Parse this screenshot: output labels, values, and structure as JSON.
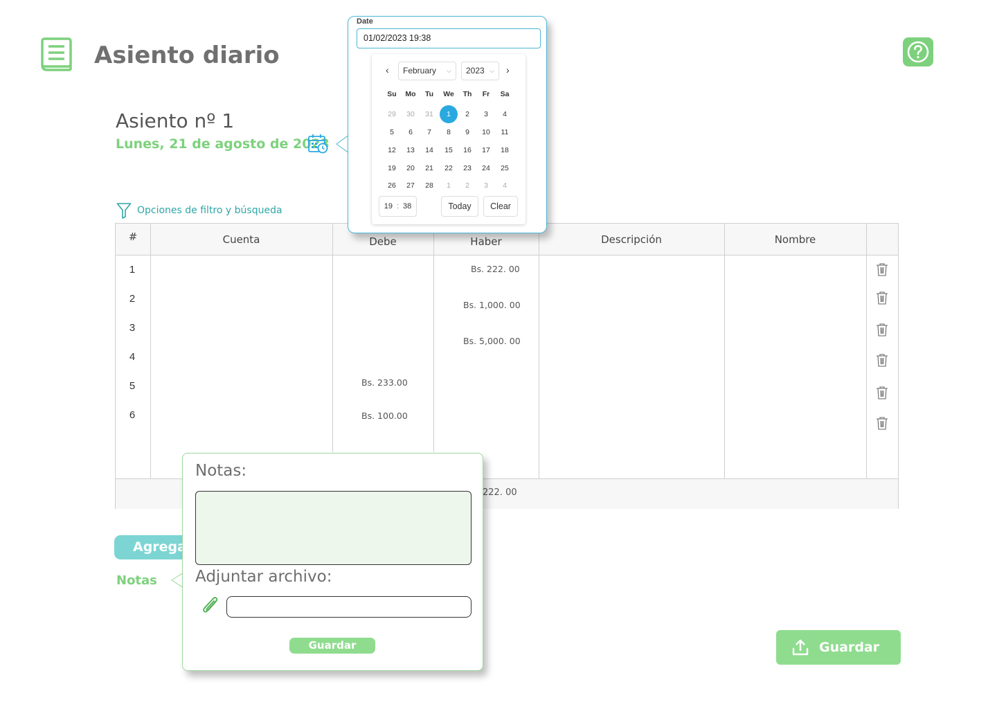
{
  "header": {
    "title": "Asiento diario",
    "book_icon": "book-icon",
    "help_icon": "question-circle-icon",
    "brand_color": "#7dd17d"
  },
  "entry": {
    "title": "Asiento nº 1",
    "date": "Lunes, 21 de agosto de 2023",
    "calendar_icon": "calendar-clock-icon"
  },
  "filter": {
    "label": "Opciones de filtro y búsqueda",
    "icon": "filter-icon"
  },
  "table": {
    "columns": [
      "#",
      "Cuenta",
      "Debe",
      "Haber",
      "Descripción",
      "Nombre",
      ""
    ],
    "rows": [
      {
        "num": "1",
        "cuenta": "",
        "debe": "",
        "haber": "Bs. 222. 00",
        "descripcion": "",
        "nombre": ""
      },
      {
        "num": "2",
        "cuenta": "",
        "debe": "",
        "haber": "Bs. 1,000. 00",
        "descripcion": "",
        "nombre": ""
      },
      {
        "num": "3",
        "cuenta": "",
        "debe": "",
        "haber": "Bs. 5,000. 00",
        "descripcion": "",
        "nombre": ""
      },
      {
        "num": "4",
        "cuenta": "",
        "debe": "",
        "haber": "",
        "descripcion": "",
        "nombre": ""
      },
      {
        "num": "5",
        "cuenta": "",
        "debe": "Bs. 233.00",
        "haber": "",
        "descripcion": "",
        "nombre": ""
      },
      {
        "num": "6",
        "cuenta": "",
        "debe": "Bs. 100.00",
        "haber": "",
        "descripcion": "",
        "nombre": ""
      }
    ],
    "footer_total_visible": "222. 00",
    "delete_icon": "trash-icon"
  },
  "actions": {
    "add_label": "Agregar",
    "notes_label": "Notas",
    "save_label": "Guardar",
    "save_icon": "upload-icon"
  },
  "notes_popover": {
    "notes_label": "Notas:",
    "notes_value": "",
    "attach_label": "Adjuntar archivo:",
    "attach_value": "",
    "attach_icon": "paperclip-icon",
    "save_label": "Guardar"
  },
  "datepicker": {
    "label": "Date",
    "value": "01/02/2023 19:38",
    "month": "February",
    "year": "2023",
    "weekdays": [
      "Su",
      "Mo",
      "Tu",
      "We",
      "Th",
      "Fr",
      "Sa"
    ],
    "weeks": [
      [
        "29",
        "30",
        "31",
        "1",
        "2",
        "3",
        "4"
      ],
      [
        "5",
        "6",
        "7",
        "8",
        "9",
        "10",
        "11"
      ],
      [
        "12",
        "13",
        "14",
        "15",
        "16",
        "17",
        "18"
      ],
      [
        "19",
        "20",
        "21",
        "22",
        "23",
        "24",
        "25"
      ],
      [
        "26",
        "27",
        "28",
        "1",
        "2",
        "3",
        "4"
      ]
    ],
    "selected_day": "1",
    "hour": "19",
    "minute": "38",
    "today_label": "Today",
    "clear_label": "Clear",
    "accent_color": "#2aa9e0"
  }
}
